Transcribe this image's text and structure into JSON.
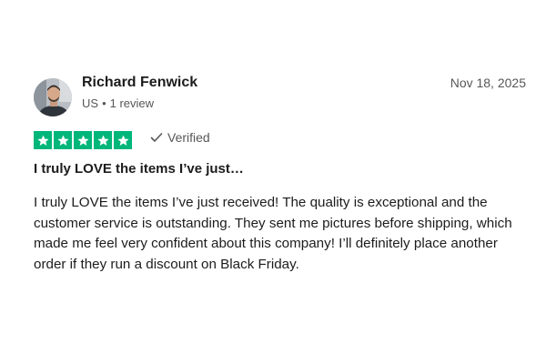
{
  "reviewer": {
    "name": "Richard Fenwick",
    "country": "US",
    "separator": "•",
    "review_count": "1 review",
    "avatar_icon": "person-photo-avatar"
  },
  "review": {
    "date": "Nov 18, 2025",
    "rating": 5,
    "rating_max": 5,
    "verified_label": "Verified",
    "title": "I truly LOVE the items I’ve just…",
    "body": "I truly LOVE the items I’ve just received! The quality is exceptional and the customer service is outstanding. They sent me pictures before shipping, which made me feel very confident about this company! I’ll definitely place another order if they run a discount on Black Friday."
  },
  "colors": {
    "star_green": "#00b67a",
    "text_primary": "#1c1c1c",
    "text_secondary": "#575757"
  },
  "icons": {
    "star": "star-icon",
    "verified": "checkmark-icon"
  }
}
